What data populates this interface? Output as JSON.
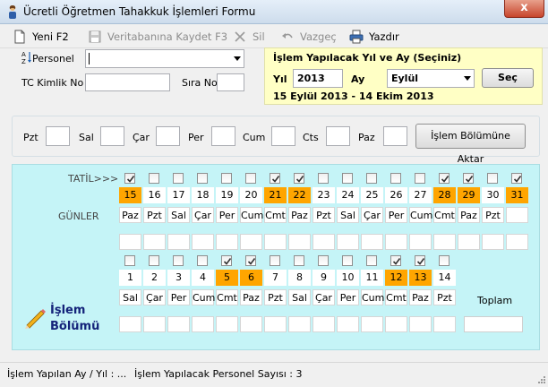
{
  "window": {
    "title": "Ücretli Öğretmen Tahakkuk İşlemleri Formu",
    "close": "x"
  },
  "toolbar": {
    "new": "Yeni  F2",
    "save": "Veritabanına Kaydet F3",
    "delete": "Sil",
    "cancel": "Vazgeç",
    "print": "Yazdır"
  },
  "form": {
    "personel_label": "Personel",
    "personel_value": "",
    "tc_label": "TC Kimlik No",
    "tc_value": "",
    "sira_label": "Sıra No",
    "sira_value": ""
  },
  "period": {
    "heading": "İşlem Yapılacak Yıl ve Ay (Seçiniz)",
    "year_label": "Yıl",
    "year": "2013",
    "month_label": "Ay",
    "month": "Eylül",
    "select_button": "Seç",
    "range": "15 Eylül 2013 - 14 Ekim 2013"
  },
  "weekdays": {
    "labels": [
      "Pzt",
      "Sal",
      "Çar",
      "Per",
      "Cum",
      "Cts",
      "Paz"
    ],
    "transfer_button": "İşlem Bölümüne Aktar"
  },
  "calendar": {
    "tatil_label": "TATİL>>>",
    "gunler_label": "GÜNLER",
    "row1": [
      {
        "day": "15",
        "name": "Paz",
        "checked": true,
        "holiday": true
      },
      {
        "day": "16",
        "name": "Pzt",
        "checked": false,
        "holiday": false
      },
      {
        "day": "17",
        "name": "Sal",
        "checked": false,
        "holiday": false
      },
      {
        "day": "18",
        "name": "Çar",
        "checked": false,
        "holiday": false
      },
      {
        "day": "19",
        "name": "Per",
        "checked": false,
        "holiday": false
      },
      {
        "day": "20",
        "name": "Cum",
        "checked": false,
        "holiday": false
      },
      {
        "day": "21",
        "name": "Cmt",
        "checked": true,
        "holiday": true
      },
      {
        "day": "22",
        "name": "Paz",
        "checked": true,
        "holiday": true
      },
      {
        "day": "23",
        "name": "Pzt",
        "checked": false,
        "holiday": false
      },
      {
        "day": "24",
        "name": "Sal",
        "checked": false,
        "holiday": false
      },
      {
        "day": "25",
        "name": "Çar",
        "checked": false,
        "holiday": false
      },
      {
        "day": "26",
        "name": "Per",
        "checked": false,
        "holiday": false
      },
      {
        "day": "27",
        "name": "Cum",
        "checked": false,
        "holiday": false
      },
      {
        "day": "28",
        "name": "Cmt",
        "checked": true,
        "holiday": true
      },
      {
        "day": "29",
        "name": "Paz",
        "checked": true,
        "holiday": true
      },
      {
        "day": "30",
        "name": "Pzt",
        "checked": false,
        "holiday": false
      },
      {
        "day": "31",
        "name": "",
        "checked": true,
        "holiday": true
      }
    ],
    "row2": [
      {
        "day": "1",
        "name": "Sal",
        "checked": false,
        "holiday": false
      },
      {
        "day": "2",
        "name": "Çar",
        "checked": false,
        "holiday": false
      },
      {
        "day": "3",
        "name": "Per",
        "checked": false,
        "holiday": false
      },
      {
        "day": "4",
        "name": "Cum",
        "checked": false,
        "holiday": false
      },
      {
        "day": "5",
        "name": "Cmt",
        "checked": true,
        "holiday": true
      },
      {
        "day": "6",
        "name": "Paz",
        "checked": true,
        "holiday": true
      },
      {
        "day": "7",
        "name": "Pzt",
        "checked": false,
        "holiday": false
      },
      {
        "day": "8",
        "name": "Sal",
        "checked": false,
        "holiday": false
      },
      {
        "day": "9",
        "name": "Çar",
        "checked": false,
        "holiday": false
      },
      {
        "day": "10",
        "name": "Per",
        "checked": false,
        "holiday": false
      },
      {
        "day": "11",
        "name": "Cum",
        "checked": false,
        "holiday": false
      },
      {
        "day": "12",
        "name": "Cmt",
        "checked": true,
        "holiday": true
      },
      {
        "day": "13",
        "name": "Paz",
        "checked": true,
        "holiday": true
      },
      {
        "day": "14",
        "name": "Pzt",
        "checked": false,
        "holiday": false
      }
    ],
    "toplam_label": "Toplam",
    "islem_line1": "İşlem",
    "islem_line2": "Bölümü"
  },
  "status": {
    "month_year": "İşlem Yapılan Ay / Yıl :  ...",
    "count": "İşlem Yapılacak Personel Sayısı :  3"
  },
  "colors": {
    "holiday": "#ffa500",
    "calendar_bg": "#c5f4f7",
    "period_bg": "#ffffc5"
  }
}
